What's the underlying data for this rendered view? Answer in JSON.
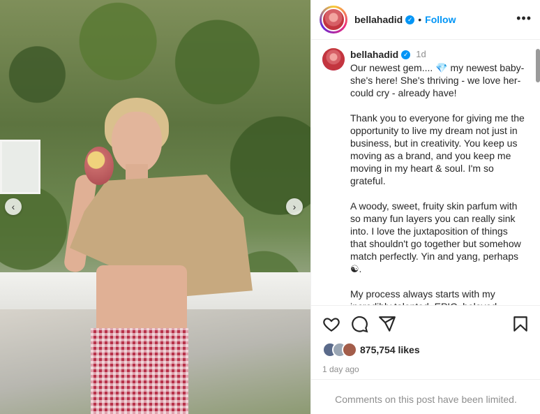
{
  "post": {
    "username": "bellahadid",
    "follow_label": "Follow",
    "separator": "•",
    "more_icon": "more-horizontal-icon",
    "time": "1d"
  },
  "caption": {
    "p1": "Our newest gem.... 💎 my newest baby- she's here! She's thriving - we love her- could cry - already have!",
    "p2": "Thank you to everyone for giving me the opportunity to live my dream not just in business, but in creativity. You keep us moving as a brand, and you keep me moving in my heart & soul. I'm so grateful.",
    "p3": "A woody, sweet, fruity skin parfum with so many fun layers you can really sink into. I love the juxtaposition of things that shouldn't go together but somehow match perfectly. Yin and yang, perhaps ☯.",
    "p4": "My process always starts with my incredibly talented, EPIC, beloved"
  },
  "actions": {
    "like_icon": "heart-icon",
    "comment_icon": "comment-icon",
    "share_icon": "share-icon",
    "save_icon": "bookmark-icon",
    "likes_text": "875,754 likes",
    "ago": "1 day ago",
    "comments_limited": "Comments on this post have been limited."
  },
  "media": {
    "prev_icon": "chevron-left-icon",
    "next_icon": "chevron-right-icon",
    "prev_glyph": "‹",
    "next_glyph": "›"
  },
  "colors": {
    "accent": "#0095f6",
    "muted": "#8e8e8e",
    "text": "#262626"
  }
}
